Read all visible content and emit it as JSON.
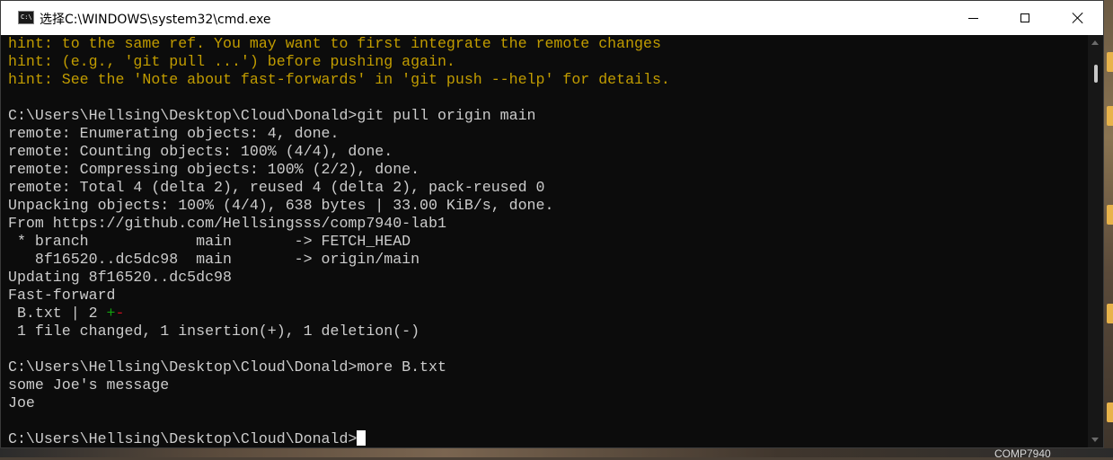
{
  "window": {
    "title": "选择C:\\WINDOWS\\system32\\cmd.exe",
    "icon": "C:\\",
    "buttons": {
      "minimize": "minimize-icon",
      "maximize": "maximize-icon",
      "close": "close-icon"
    }
  },
  "desktop": {
    "label": "COMP7940"
  },
  "colors": {
    "console_bg": "#0c0c0c",
    "console_text": "#cccccc",
    "hint_text": "#c19c00",
    "insertion_marker": "#13a10e",
    "deletion_marker": "#c50f1f"
  },
  "console": {
    "lines": [
      "hint: to the same ref. You may want to first integrate the remote changes",
      "hint: (e.g., 'git pull ...') before pushing again.",
      "hint: See the 'Note about fast-forwards' in 'git push --help' for details.",
      "",
      "C:\\Users\\Hellsing\\Desktop\\Cloud\\Donald>git pull origin main",
      "remote: Enumerating objects: 4, done.",
      "remote: Counting objects: 100% (4/4), done.",
      "remote: Compressing objects: 100% (2/2), done.",
      "remote: Total 4 (delta 2), reused 4 (delta 2), pack-reused 0",
      "Unpacking objects: 100% (4/4), 638 bytes | 33.00 KiB/s, done.",
      "From https://github.com/Hellsingsss/comp7940-lab1",
      " * branch            main       -> FETCH_HEAD",
      "   8f16520..dc5dc98  main       -> origin/main",
      "Updating 8f16520..dc5dc98",
      "Fast-forward"
    ],
    "diffstat": {
      "prefix": " B.txt | 2 ",
      "plus": "+",
      "minus": "-"
    },
    "lines2": [
      " 1 file changed, 1 insertion(+), 1 deletion(-)",
      "",
      "C:\\Users\\Hellsing\\Desktop\\Cloud\\Donald>more B.txt",
      "some Joe's message",
      "Joe",
      ""
    ],
    "prompt": "C:\\Users\\Hellsing\\Desktop\\Cloud\\Donald>"
  }
}
